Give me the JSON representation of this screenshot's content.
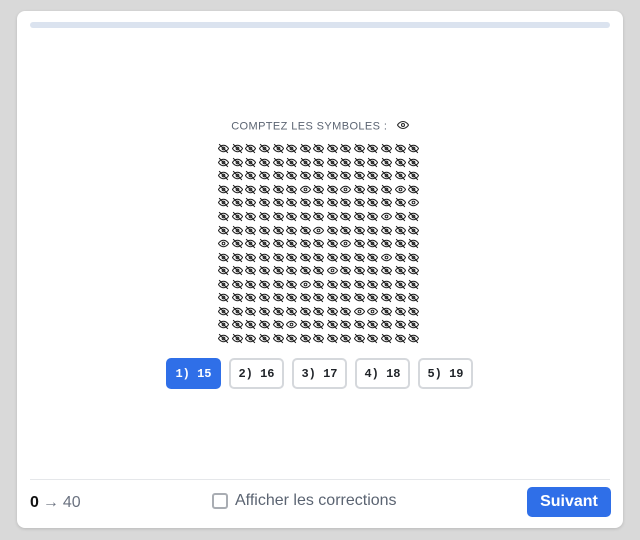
{
  "progress": {
    "fraction": 0.0
  },
  "prompt": {
    "text": "COMPTEZ LES SYMBOLES :",
    "target_icon": "eye-icon"
  },
  "grid": {
    "columns": 15,
    "rows": 15,
    "target_symbol": "eye-icon",
    "other_symbol": "eye-slash-icon",
    "target_positions": [
      [
        3,
        6
      ],
      [
        3,
        9
      ],
      [
        3,
        13
      ],
      [
        4,
        14
      ],
      [
        5,
        12
      ],
      [
        6,
        7
      ],
      [
        7,
        0
      ],
      [
        7,
        9
      ],
      [
        8,
        12
      ],
      [
        9,
        8
      ],
      [
        10,
        6
      ],
      [
        12,
        10
      ],
      [
        12,
        11
      ],
      [
        13,
        5
      ]
    ]
  },
  "options": [
    {
      "label": "1) 15",
      "selected": true
    },
    {
      "label": "2) 16",
      "selected": false
    },
    {
      "label": "3) 17",
      "selected": false
    },
    {
      "label": "4) 18",
      "selected": false
    },
    {
      "label": "5) 19",
      "selected": false
    }
  ],
  "footer": {
    "score_current": "0",
    "score_arrow": "→",
    "score_total": "40",
    "corrections_label": "Afficher les corrections",
    "corrections_checked": false,
    "next_label": "Suivant"
  },
  "colors": {
    "accent": "#2f6fe8",
    "progress_track": "#dbe3ef",
    "muted_text": "#5b6472"
  }
}
